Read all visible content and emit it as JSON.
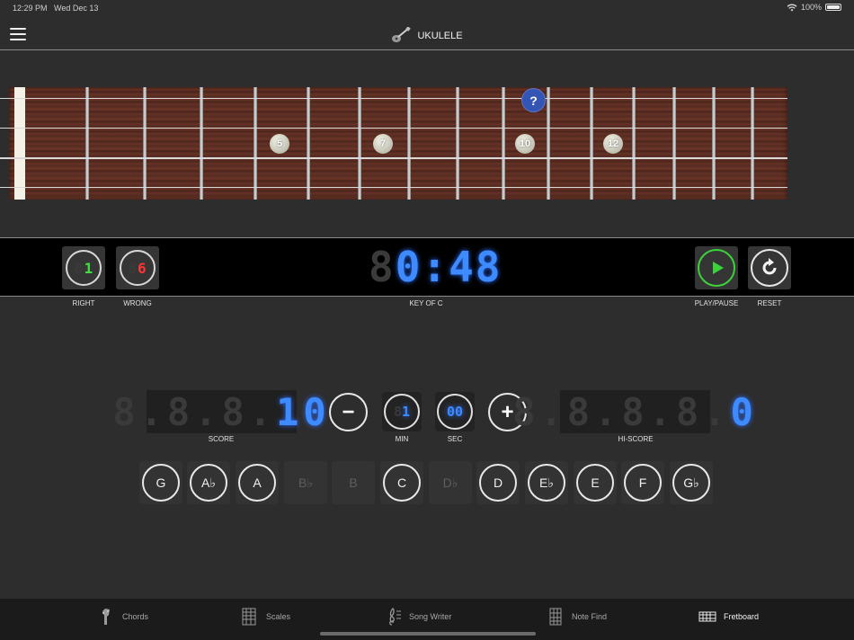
{
  "status": {
    "time": "12:29 PM",
    "date": "Wed Dec 13",
    "battery": "100%"
  },
  "nav": {
    "title": "UKULELE"
  },
  "fretboard": {
    "inlays": [
      "5",
      "7",
      "10",
      "12"
    ],
    "question_marker": "?"
  },
  "strip": {
    "right": {
      "ghost": "88",
      "value": "1",
      "label": "RIGHT"
    },
    "wrong": {
      "ghost": "8",
      "value": "6",
      "label": "WRONG"
    },
    "timer": {
      "ghost": "8",
      "value": "0:48"
    },
    "key_label": "KEY OF C",
    "play_label": "PLAY/PAUSE",
    "reset_label": "RESET"
  },
  "score": {
    "ghost": "8.8.8.",
    "value": "10",
    "label": "SCORE"
  },
  "hiscore": {
    "ghost": "8.8.8.8.",
    "value": "0",
    "label": "HI-SCORE"
  },
  "minutes": {
    "ghost": "8",
    "value": "1",
    "label": "MIN"
  },
  "seconds": {
    "value": "00",
    "label": "SEC"
  },
  "stepper": {
    "minus": "−",
    "plus": "+"
  },
  "notes": [
    {
      "label": "G",
      "enabled": true
    },
    {
      "label": "A♭",
      "enabled": true
    },
    {
      "label": "A",
      "enabled": true
    },
    {
      "label": "B♭",
      "enabled": false
    },
    {
      "label": "B",
      "enabled": false
    },
    {
      "label": "C",
      "enabled": true
    },
    {
      "label": "D♭",
      "enabled": false
    },
    {
      "label": "D",
      "enabled": true
    },
    {
      "label": "E♭",
      "enabled": true
    },
    {
      "label": "E",
      "enabled": true
    },
    {
      "label": "F",
      "enabled": true
    },
    {
      "label": "G♭",
      "enabled": true
    }
  ],
  "tabs": [
    {
      "label": "Chords",
      "icon": "guitar-headstock-icon",
      "active": false
    },
    {
      "label": "Scales",
      "icon": "scale-grid-icon",
      "active": false
    },
    {
      "label": "Song Writer",
      "icon": "treble-clef-icon",
      "active": false
    },
    {
      "label": "Note Find",
      "icon": "fret-grid-icon",
      "active": false
    },
    {
      "label": "Fretboard",
      "icon": "fretboard-icon",
      "active": true
    }
  ],
  "colors": {
    "accent_blue": "#3d8bff",
    "right_green": "#3fe03f",
    "wrong_red": "#ff3434",
    "play_green": "#3bd23b",
    "marker_blue": "#3455b3"
  }
}
